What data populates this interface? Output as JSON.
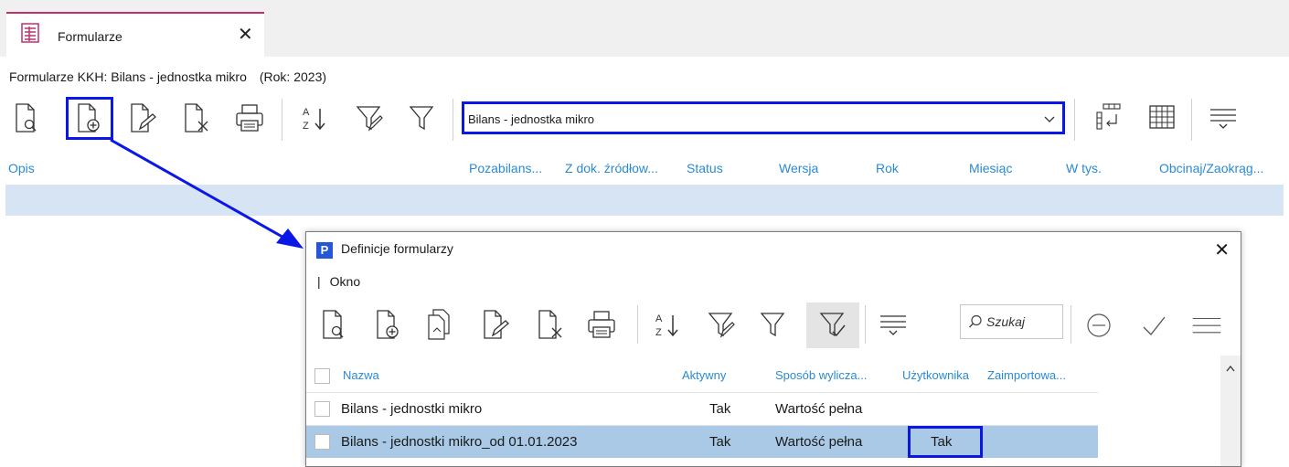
{
  "tab": {
    "label": "Formularze",
    "close": "✕"
  },
  "context": {
    "title": "Formularze KKH: Bilans - jednostka mikro",
    "year": "(Rok: 2023)"
  },
  "form_select": {
    "value": "Bilans - jednostka mikro"
  },
  "main_columns": [
    "Opis",
    "Pozabilans...",
    "Z dok. źródłow...",
    "Status",
    "Wersja",
    "Rok",
    "Miesiąc",
    "W tys.",
    "Obcinaj/Zaokrąg..."
  ],
  "dialog": {
    "title": "Definicje formularzy",
    "close": "✕",
    "menu": {
      "bar": "|",
      "okno": "Okno"
    },
    "search_placeholder": "Szukaj",
    "columns": [
      "Nazwa",
      "Aktywny",
      "Sposób wylicza...",
      "Użytkownika",
      "Zaimportowa..."
    ],
    "rows": [
      {
        "nazwa": "Bilans - jednostki mikro",
        "aktywny": "Tak",
        "sposob": "Wartość pełna",
        "uzytkownika": "",
        "zaimportowany": ""
      },
      {
        "nazwa": "Bilans - jednostki mikro_od 01.01.2023",
        "aktywny": "Tak",
        "sposob": "Wartość pełna",
        "uzytkownika": "Tak",
        "zaimportowany": ""
      }
    ]
  },
  "colors": {
    "accent": "#2a8ad4",
    "highlight_border": "#0a17e6",
    "selected_row": "#a9c9e6",
    "header_band": "#d6e4f3"
  }
}
